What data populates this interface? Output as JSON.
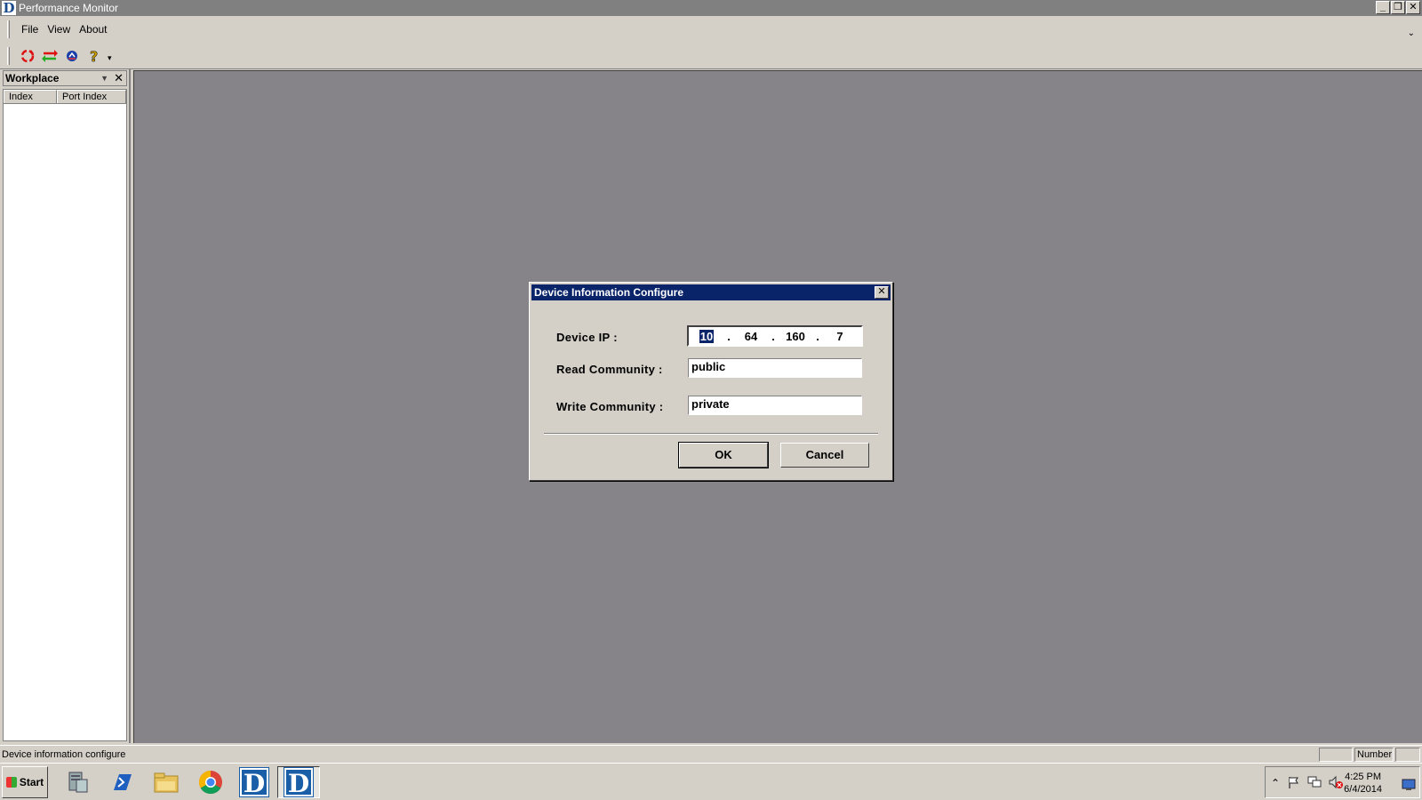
{
  "window": {
    "title": "Performance Monitor",
    "logo_letter": "D",
    "minimize_glyph": "_",
    "restore_glyph": "❐",
    "close_glyph": "✕"
  },
  "menu": {
    "items": [
      "File",
      "View",
      "About"
    ],
    "chevron": "⌄"
  },
  "toolbar": {
    "icons": [
      "refresh-icon",
      "transfer-icon",
      "connect-icon",
      "help-icon"
    ],
    "dropdown_glyph": "▾"
  },
  "workplace": {
    "title": "Workplace",
    "close_glyph": "✕",
    "dropdown_glyph": "▼",
    "columns": [
      "Index",
      "Port Index"
    ]
  },
  "dialog": {
    "title": "Device Information Configure",
    "close_glyph": "✕",
    "device_ip_label": "Device IP :",
    "ip_octets": [
      "10",
      "64",
      "160",
      "7"
    ],
    "ip_separator": ".",
    "read_community_label": "Read Community :",
    "read_community_value": "public",
    "write_community_label": "Write Community :",
    "write_community_value": "private",
    "ok_label": "OK",
    "cancel_label": "Cancel"
  },
  "statusbar": {
    "text": "Device information configure",
    "pane_number": "Number"
  },
  "taskbar": {
    "start_label": "Start",
    "apps": [
      "server-manager-icon",
      "powershell-icon",
      "file-explorer-icon",
      "chrome-icon",
      "dlink-app-icon",
      "dlink-performance-monitor-icon"
    ],
    "clock_time": "4:25 PM",
    "clock_date": "6/4/2014"
  },
  "colors": {
    "title_bar": "#808080",
    "dialog_title": "#0a246a",
    "mdi_background": "#868488",
    "chrome": "#d4d0c8",
    "dlink_blue": "#1a5ea8"
  }
}
